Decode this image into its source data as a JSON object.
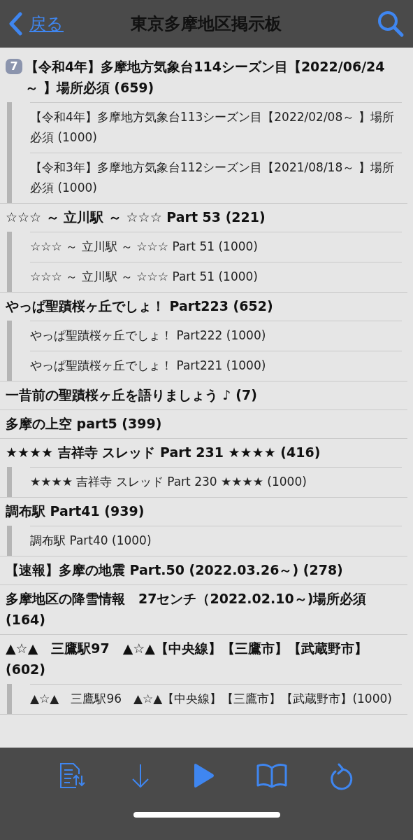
{
  "nav": {
    "back_label": "戻る",
    "title": "東京多摩地区掲示板"
  },
  "threads": [
    {
      "badge": "7",
      "title": "【令和4年】多摩地方気象台114シーズン目【2022/06/24～ 】場所必須 (659)",
      "children": [
        {
          "title": "【令和4年】多摩地方気象台113シーズン目【2022/02/08～ 】場所必須 (1000)"
        },
        {
          "title": "【令和3年】多摩地方気象台112シーズン目【2021/08/18～ 】場所必須 (1000)"
        }
      ]
    },
    {
      "title": "☆☆☆ ～ 立川駅 ～ ☆☆☆ Part 53 (221)",
      "children": [
        {
          "title": "☆☆☆ ～ 立川駅 ～ ☆☆☆ Part 51 (1000)"
        },
        {
          "title": "☆☆☆ ～ 立川駅 ～ ☆☆☆ Part 51 (1000)"
        }
      ]
    },
    {
      "title": "やっぱ聖蹟桜ヶ丘でしょ！ Part223 (652)",
      "children": [
        {
          "title": "やっぱ聖蹟桜ヶ丘でしょ！ Part222 (1000)"
        },
        {
          "title": "やっぱ聖蹟桜ヶ丘でしょ！ Part221 (1000)"
        }
      ]
    },
    {
      "title": "一昔前の聖蹟桜ヶ丘を語りましょう ♪ (7)"
    },
    {
      "title": "多摩の上空 part5 (399)"
    },
    {
      "title": "★★★★ 吉祥寺 スレッド Part 231 ★★★★ (416)",
      "children": [
        {
          "title": "★★★★ 吉祥寺 スレッド Part 230 ★★★★ (1000)"
        }
      ]
    },
    {
      "title": "調布駅 Part41 (939)",
      "children": [
        {
          "title": "調布駅 Part40 (1000)"
        }
      ]
    },
    {
      "title": "【速報】多摩の地震 Part.50 (2022.03.26～) (278)"
    },
    {
      "title": "多摩地区の降雪情報　27センチ（2022.02.10～)場所必須 (164)"
    },
    {
      "title": "▲☆▲　三鷹駅97　▲☆▲【中央線】【三鷹市】【武蔵野市】(602)",
      "children": [
        {
          "title": "▲☆▲　三鷹駅96　▲☆▲【中央線】【三鷹市】【武蔵野市】(1000)"
        }
      ]
    }
  ]
}
